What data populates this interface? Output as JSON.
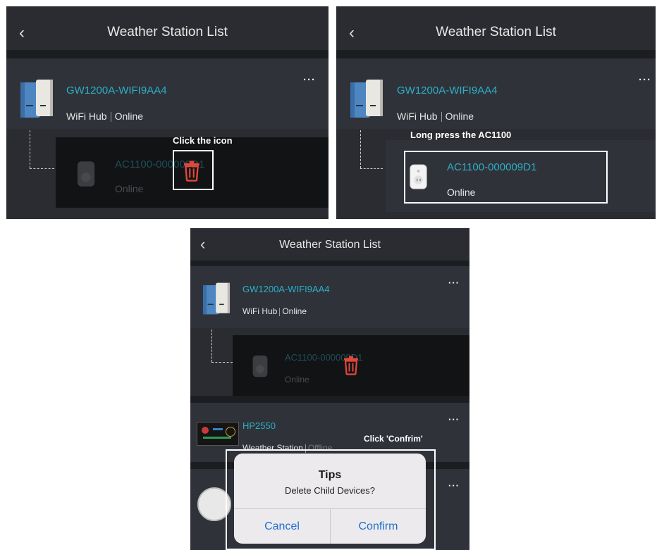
{
  "colors": {
    "bg": "#2a2c31",
    "row": "#30323a",
    "accent": "#2ab0c6",
    "delete": "#e2473b",
    "dialog_button": "#1e6fd0"
  },
  "header": {
    "title": "Weather Station List",
    "back_icon": "chevron-left-icon"
  },
  "gateway": {
    "name": "GW1200A-WIFI9AA4",
    "type": "WiFi Hub",
    "status": "Online",
    "menu": "···"
  },
  "child": {
    "name": "AC1100-000009D1",
    "status": "Online"
  },
  "station": {
    "name": "HP2550",
    "type": "Weather Station",
    "status": "Offline"
  },
  "annotations": {
    "step1": "Click the icon",
    "step2": "Long press the AC1100",
    "step3": "Click 'Confrim'"
  },
  "dialog": {
    "title": "Tips",
    "message": "Delete Child Devices?",
    "cancel": "Cancel",
    "confirm": "Confirm"
  }
}
